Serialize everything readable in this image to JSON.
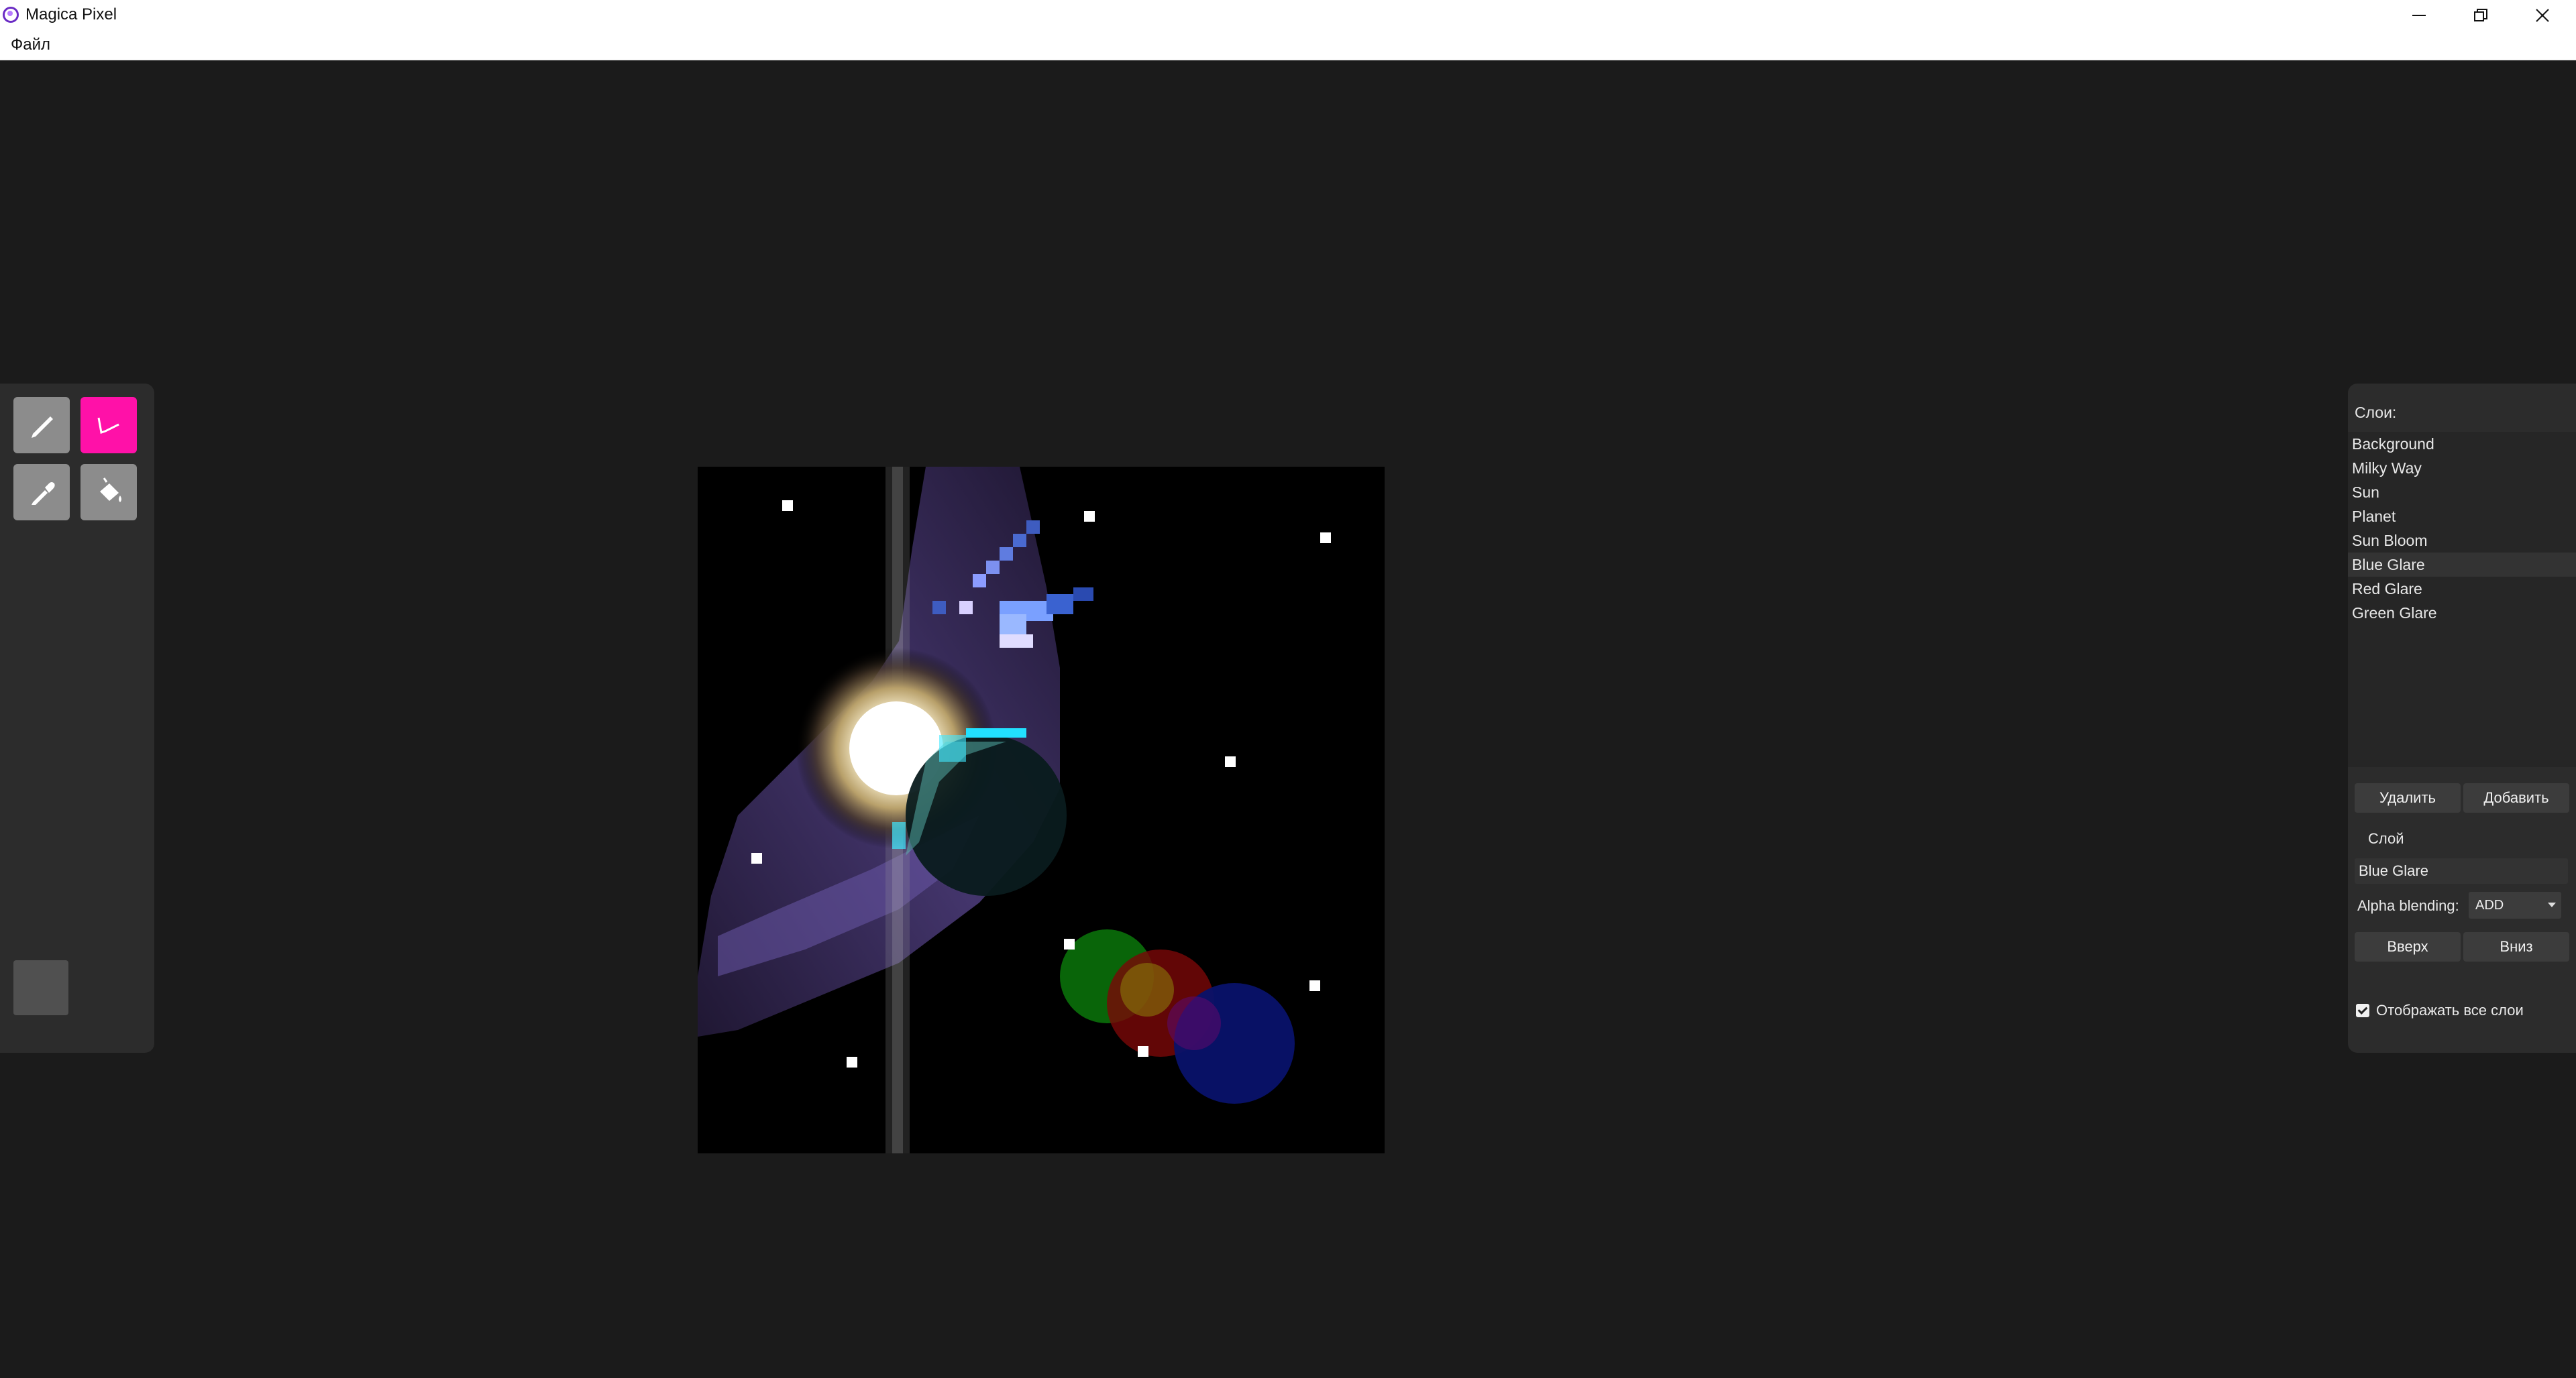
{
  "window": {
    "title": "Magica Pixel",
    "app_icon": "magica-pixel-logo-icon",
    "controls": [
      "minimize-icon",
      "restore-icon",
      "close-icon"
    ]
  },
  "menu": {
    "file": "Файл"
  },
  "tools": {
    "items": [
      {
        "name": "pencil-icon",
        "active": false
      },
      {
        "name": "line-brush-icon",
        "active": true
      },
      {
        "name": "eyedropper-icon",
        "active": false
      },
      {
        "name": "fill-bucket-icon",
        "active": false
      }
    ],
    "colors": {
      "active": "#ff11a8",
      "inactive": "#8c8c8c",
      "current_color": "#505050"
    }
  },
  "layers": {
    "caption": "Слои:",
    "items": [
      "Background",
      "Milky Way",
      "Sun",
      "Planet",
      "Sun Bloom",
      "Blue Glare",
      "Red Glare",
      "Green Glare"
    ],
    "selected": "Blue Glare",
    "delete_label": "Удалить",
    "add_label": "Добавить",
    "layer_section_label": "Слой",
    "layer_name_value": "Blue Glare",
    "alpha_blending_label": "Alpha blending:",
    "alpha_blending_value": "ADD",
    "up_label": "Вверх",
    "down_label": "Вниз",
    "show_all_label": "Отображать все слои",
    "show_all_checked": true
  }
}
